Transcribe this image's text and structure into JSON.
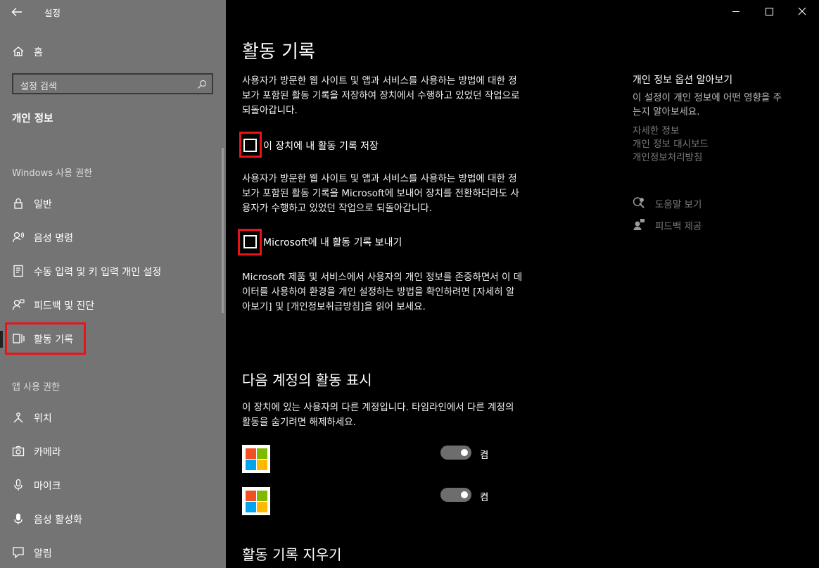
{
  "window": {
    "title": "설정",
    "controls": [
      "minimize",
      "maximize",
      "close"
    ]
  },
  "sidebar": {
    "home_label": "홈",
    "search_placeholder": "설정 검색",
    "category_title": "개인 정보",
    "windows_section": "Windows 사용 권한",
    "windows_items": [
      {
        "label": "일반",
        "icon": "lock-icon"
      },
      {
        "label": "음성 명령",
        "icon": "speech-icon"
      },
      {
        "label": "수동 입력 및 키 입력 개인 설정",
        "icon": "inking-typing-icon"
      },
      {
        "label": "피드백 및 진단",
        "icon": "feedback-diagnostics-icon"
      },
      {
        "label": "활동 기록",
        "icon": "activity-history-icon",
        "selected": true
      }
    ],
    "app_section": "앱 사용 권한",
    "app_items": [
      {
        "label": "위치",
        "icon": "location-icon"
      },
      {
        "label": "카메라",
        "icon": "camera-icon"
      },
      {
        "label": "마이크",
        "icon": "microphone-icon"
      },
      {
        "label": "음성 활성화",
        "icon": "voice-activation-icon"
      },
      {
        "label": "알림",
        "icon": "notification-icon"
      }
    ]
  },
  "main": {
    "title": "활동 기록",
    "desc1_lines": [
      "사용자가 방문한 웹 사이트 및 앱과 서비스를 사용하는 방법에 대한 정",
      "보가 포함된 활동 기록을 저장하여 장치에서 수행하고 있었던 작업으로",
      "되돌아갑니다."
    ],
    "checkbox1": {
      "label": "이 장치에 내 활동 기록 저장",
      "checked": false
    },
    "desc2_lines": [
      "사용자가 방문한 웹 사이트 및 앱과 서비스를 사용하는 방법에 대한 정",
      "보가 포함된 활동 기록을 Microsoft에 보내어 장치를 전환하더라도 사",
      "용자가 수행하고 있었던 작업으로 되돌아갑니다."
    ],
    "checkbox2": {
      "label": "Microsoft에 내 활동 기록 보내기",
      "checked": false
    },
    "desc3_lines": [
      "Microsoft 제품 및 서비스에서 사용자의 개인 정보를 존중하면서 이 데",
      "이터를 사용하여 환경을 개인 설정하는 방법을 확인하려면 [자세히 알",
      "아보기] 및 [개인정보취급방침]을 읽어 보세요."
    ],
    "accounts_heading": "다음 계정의 활동 표시",
    "accounts_desc_lines": [
      "이 장치에 있는 사용자의 다른 계정입니다. 타임라인에서 다른 계정의",
      "활동을 숨기려면 해제하세요."
    ],
    "accounts": [
      {
        "toggle_label": "켬",
        "on": true
      },
      {
        "toggle_label": "켬",
        "on": true
      }
    ],
    "clear_heading": "활동 기록 지우기"
  },
  "aside": {
    "heading": "개인 정보 옵션 알아보기",
    "desc_lines": [
      "이 설정이 개인 정보에 어떤 영향을 주",
      "는지 알아보세요."
    ],
    "links": [
      "자세한 정보",
      "개인 정보 대시보드",
      "개인정보처리방침"
    ],
    "help_label": "도움말 보기",
    "feedback_label": "피드백 제공"
  },
  "colors": {
    "sidebar_bg": "#747474",
    "main_bg": "#000000",
    "highlight": "#e8141a",
    "ms_red": "#f25022",
    "ms_green": "#7fba00",
    "ms_blue": "#00a4ef",
    "ms_yellow": "#ffb900"
  }
}
